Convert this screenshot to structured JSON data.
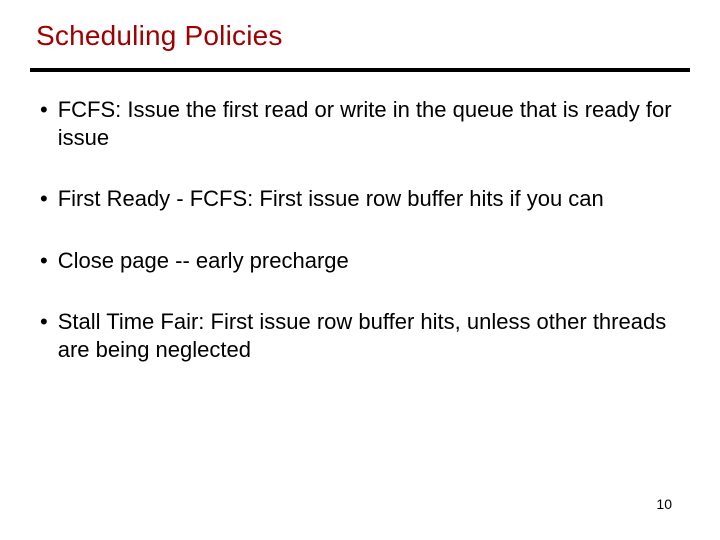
{
  "slide": {
    "title": "Scheduling Policies",
    "bullets": [
      "FCFS: Issue the first read or write in the queue that is ready for issue",
      "First Ready - FCFS: First issue row buffer hits if you can",
      "Close page -- early precharge",
      "Stall Time Fair: First issue row buffer hits, unless other threads are being neglected"
    ],
    "page_number": "10"
  }
}
